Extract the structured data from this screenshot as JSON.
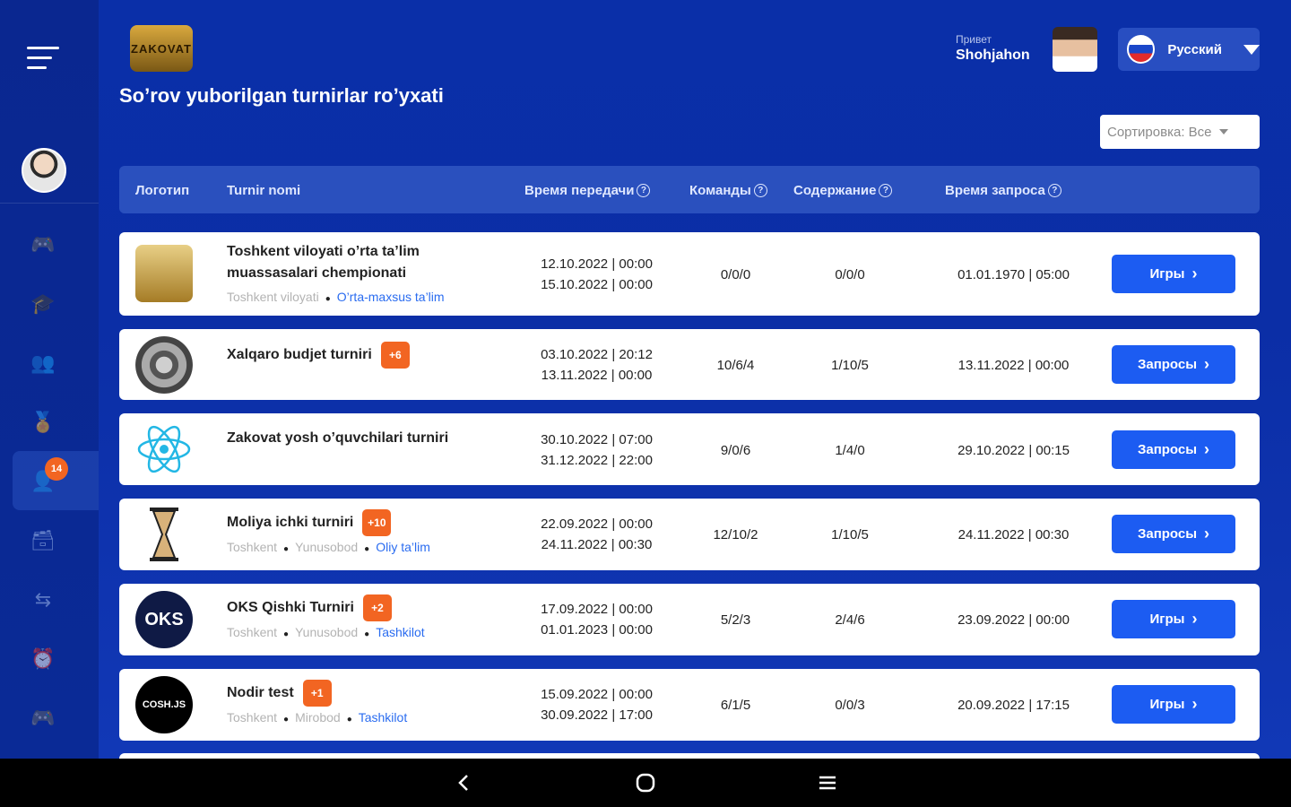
{
  "header": {
    "logo_text": "ZAKOVAT",
    "title": "So’rov yuborilgan turnirlar ro’yxati",
    "greeting": "Привет",
    "user_name": "Shohjahon",
    "language": "Русский",
    "sort_label": "Сортировка: Все"
  },
  "sidebar": {
    "badge_count": "14",
    "icons": [
      "menu-icon",
      "gamepad-icon",
      "graduate-icon",
      "team-icon",
      "medal-icon",
      "user-requests-icon",
      "archive-icon",
      "transfer-icon",
      "alarm-icon",
      "gamepad-icon"
    ]
  },
  "table": {
    "columns": {
      "logo": "Логотип",
      "name": "Turnir nomi",
      "broadcast_time": "Время передачи",
      "teams": "Команды",
      "content": "Содержание",
      "request_time": "Время запроса"
    },
    "help_glyph": "?",
    "rows": [
      {
        "name_line1": "Toshkent viloyati o’rta ta’lim",
        "name_line2": "muassasalari chempionati",
        "badge": "",
        "meta": [
          "Toshkent viloyati",
          "O’rta-maxsus ta’lim"
        ],
        "time1": "12.10.2022 | 00:00",
        "time2": "15.10.2022 | 00:00",
        "teams": "0/0/0",
        "content": "0/0/0",
        "request_time": "01.01.1970 | 05:00",
        "button": "Игры"
      },
      {
        "name_line1": "Xalqaro budjet turniri",
        "badge": "+6",
        "meta": [],
        "time1": "03.10.2022 | 20:12",
        "time2": "13.11.2022 | 00:00",
        "teams": "10/6/4",
        "content": "1/10/5",
        "request_time": "13.11.2022 | 00:00",
        "button": "Запросы"
      },
      {
        "name_line1": "Zakovat yosh o’quvchilari turniri",
        "badge": "",
        "meta": [],
        "time1": "30.10.2022 | 07:00",
        "time2": "31.12.2022 | 22:00",
        "teams": "9/0/6",
        "content": "1/4/0",
        "request_time": "29.10.2022 | 00:15",
        "button": "Запросы"
      },
      {
        "name_line1": "Moliya ichki turniri",
        "badge": "+10",
        "meta": [
          "Toshkent",
          "Yunusobod",
          "Oliy ta’lim"
        ],
        "time1": "22.09.2022 | 00:00",
        "time2": "24.11.2022 | 00:30",
        "teams": "12/10/2",
        "content": "1/10/5",
        "request_time": "24.11.2022 | 00:30",
        "button": "Запросы"
      },
      {
        "name_line1": "OKS Qishki Turniri",
        "badge": "+2",
        "meta": [
          "Toshkent",
          "Yunusobod",
          "Tashkilot"
        ],
        "logo_text": "OKS",
        "time1": "17.09.2022 | 00:00",
        "time2": "01.01.2023 | 00:00",
        "teams": "5/2/3",
        "content": "2/4/6",
        "request_time": "23.09.2022 | 00:00",
        "button": "Игры"
      },
      {
        "name_line1": "Nodir test",
        "badge": "+1",
        "meta": [
          "Toshkent",
          "Mirobod",
          "Tashkilot"
        ],
        "logo_text": "COSH.JS",
        "time1": "15.09.2022 | 00:00",
        "time2": "30.09.2022 | 17:00",
        "teams": "6/1/5",
        "content": "0/0/3",
        "request_time": "20.09.2022 | 17:15",
        "button": "Игры"
      }
    ]
  },
  "colors": {
    "background": "#0b2ea6",
    "accent_button": "#1c5cf2",
    "badge": "#f26522",
    "link": "#2a6cf0"
  }
}
